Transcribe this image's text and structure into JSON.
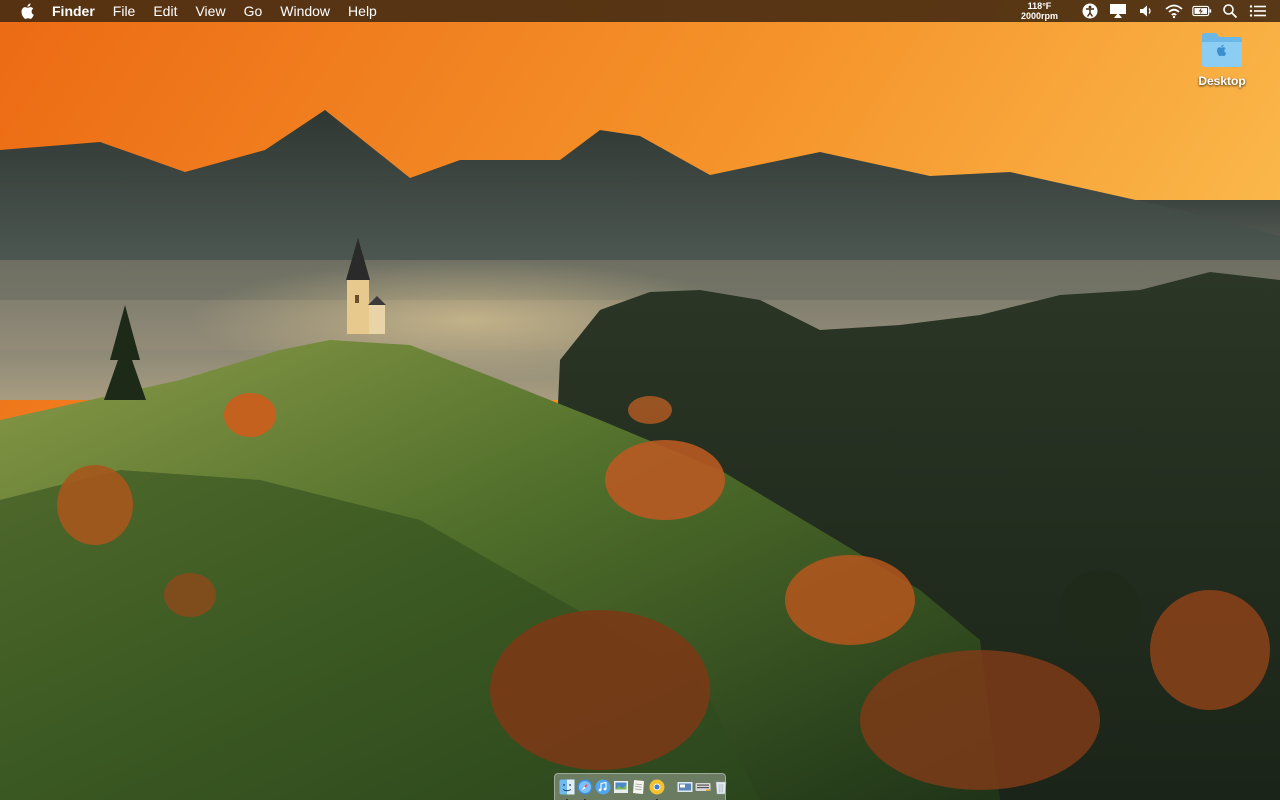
{
  "menubar": {
    "apple_icon": "apple-logo-icon",
    "app_name": "Finder",
    "menus": [
      "File",
      "Edit",
      "View",
      "Go",
      "Window",
      "Help"
    ],
    "status": {
      "temperature": "118°F",
      "fan_speed": "2000rpm",
      "icons": [
        "accessibility-icon",
        "airplay-display-icon",
        "volume-icon",
        "wifi-icon",
        "battery-charging-icon",
        "spotlight-search-icon",
        "notification-center-icon"
      ]
    }
  },
  "desktop": {
    "folder_label": "Desktop",
    "folder_icon": "folder-icon"
  },
  "dock": {
    "apps": [
      {
        "name": "Finder",
        "icon": "finder-icon",
        "running": true
      },
      {
        "name": "Safari",
        "icon": "safari-icon",
        "running": true
      },
      {
        "name": "iTunes",
        "icon": "itunes-icon",
        "running": false
      },
      {
        "name": "Preview",
        "icon": "preview-icon",
        "running": false
      },
      {
        "name": "TextEdit",
        "icon": "textedit-icon",
        "running": false
      },
      {
        "name": "Chrome",
        "icon": "chrome-icon",
        "running": true
      }
    ],
    "others": [
      {
        "name": "Screenshot",
        "icon": "screenshot-icon"
      },
      {
        "name": "Keyboard",
        "icon": "keyboard-icon"
      },
      {
        "name": "Trash",
        "icon": "trash-icon"
      }
    ]
  },
  "colors": {
    "menubar_bg": "#4a2e12",
    "sky_top": "#f07a1e",
    "sky_bottom": "#f9b14a",
    "hill_green": "#4f6b2a",
    "foliage_orange": "#c0601e"
  }
}
